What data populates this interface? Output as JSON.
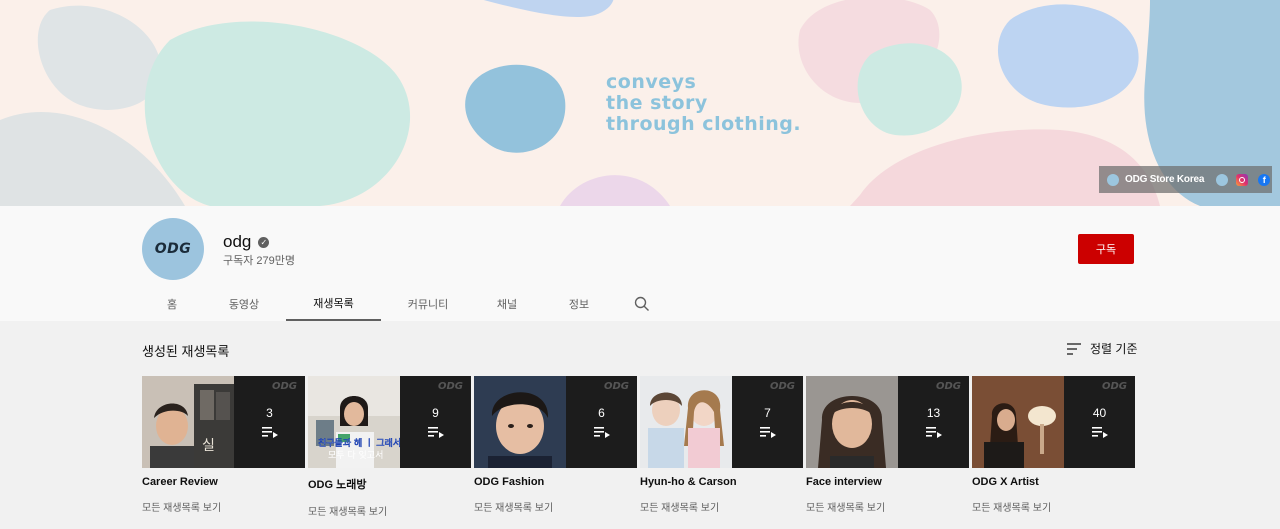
{
  "banner": {
    "tagline": [
      "conveys",
      "the story",
      "through clothing."
    ],
    "link_label": "ODG Store Korea",
    "link_icons": [
      "globe-icon",
      "instagram-icon",
      "facebook-icon"
    ]
  },
  "channel": {
    "avatar_text": "ODG",
    "name": "odg",
    "subscribers": "구독자 279만명",
    "subscribe_label": "구독"
  },
  "tabs": [
    {
      "label": "홈",
      "active": false
    },
    {
      "label": "동영상",
      "active": false
    },
    {
      "label": "재생목록",
      "active": true
    },
    {
      "label": "커뮤니티",
      "active": false
    },
    {
      "label": "채널",
      "active": false
    },
    {
      "label": "정보",
      "active": false
    }
  ],
  "section": {
    "title": "생성된 재생목록",
    "sort_label": "정렬 기준"
  },
  "playlists": [
    {
      "title": "Career Review",
      "count": "3",
      "link": "모든 재생목록 보기",
      "watermark": "ODG"
    },
    {
      "title": "ODG 노래방",
      "count": "9",
      "link": "모든 재생목록 보기",
      "watermark": "ODG",
      "caption": [
        "친구들과 헤 ㅣ 그래서",
        "모두 다 잊고서"
      ]
    },
    {
      "title": "ODG Fashion",
      "count": "6",
      "link": "모든 재생목록 보기",
      "watermark": "ODG"
    },
    {
      "title": "Hyun-ho & Carson",
      "count": "7",
      "link": "모든 재생목록 보기",
      "watermark": "ODG"
    },
    {
      "title": "Face interview",
      "count": "13",
      "link": "모든 재생목록 보기",
      "watermark": "ODG"
    },
    {
      "title": "ODG X Artist",
      "count": "40",
      "link": "모든 재생목록 보기",
      "watermark": "ODG"
    }
  ]
}
